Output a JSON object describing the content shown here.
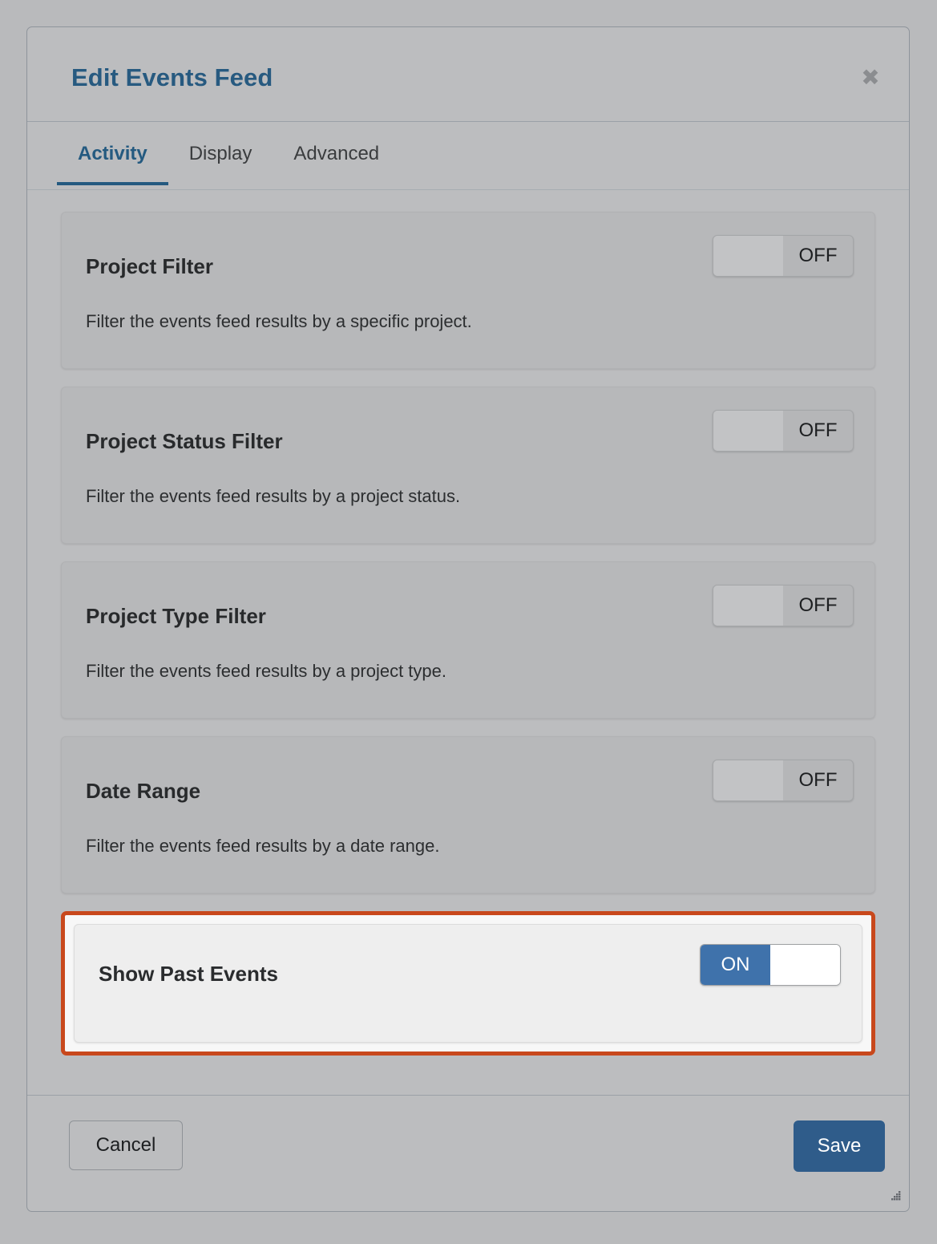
{
  "dialog": {
    "title": "Edit Events Feed",
    "close_icon": "close-icon",
    "close_glyph": "✖"
  },
  "tabs": [
    {
      "label": "Activity",
      "active": true
    },
    {
      "label": "Display",
      "active": false
    },
    {
      "label": "Advanced",
      "active": false
    }
  ],
  "settings": [
    {
      "title": "Project Filter",
      "description": "Filter the events feed results by a specific project.",
      "toggle_state": "OFF",
      "highlighted": false
    },
    {
      "title": "Project Status Filter",
      "description": "Filter the events feed results by a project status.",
      "toggle_state": "OFF",
      "highlighted": false
    },
    {
      "title": "Project Type Filter",
      "description": "Filter the events feed results by a project type.",
      "toggle_state": "OFF",
      "highlighted": false
    },
    {
      "title": "Date Range",
      "description": "Filter the events feed results by a date range.",
      "toggle_state": "OFF",
      "highlighted": false
    },
    {
      "title": "Show Past Events",
      "description": "",
      "toggle_state": "ON",
      "highlighted": true
    }
  ],
  "footer": {
    "cancel_label": "Cancel",
    "save_label": "Save",
    "resize_icon": "resize-grip-icon"
  },
  "colors": {
    "accent_blue": "#275a80",
    "toggle_on_blue": "#3f72ab",
    "save_blue": "#2f5c8a",
    "highlight_orange": "#c8481c",
    "dialog_bg": "#bcbdbf",
    "page_bg": "#b9babc"
  }
}
